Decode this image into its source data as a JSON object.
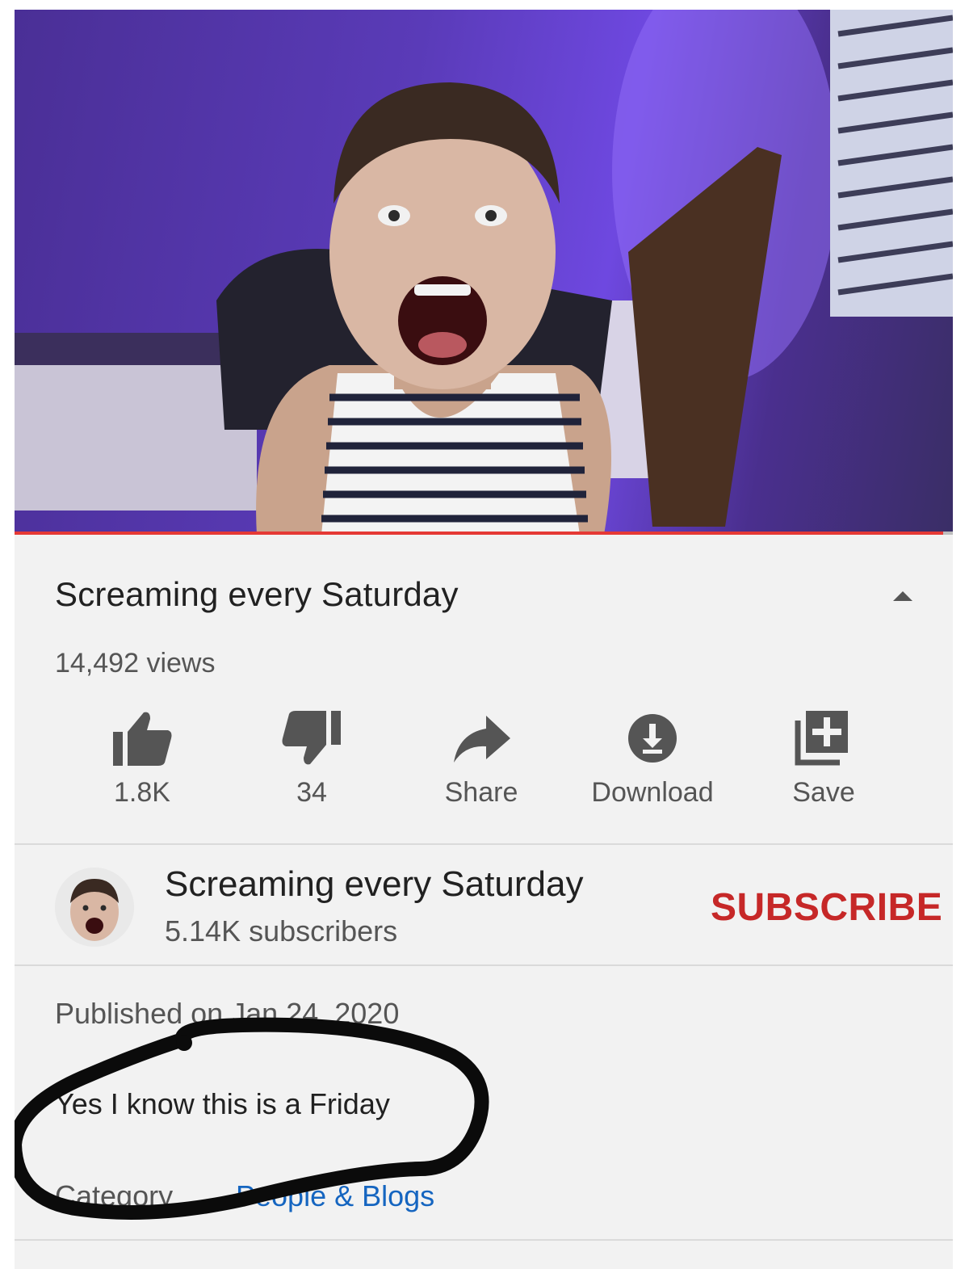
{
  "video": {
    "progress_fraction": 0.99
  },
  "title": "Screaming every Saturday",
  "views": "14,492 views",
  "actions": {
    "like": {
      "label": "1.8K",
      "icon": "thumb-up-icon"
    },
    "dislike": {
      "label": "34",
      "icon": "thumb-down-icon"
    },
    "share": {
      "label": "Share",
      "icon": "share-arrow-icon"
    },
    "download": {
      "label": "Download",
      "icon": "download-icon"
    },
    "save": {
      "label": "Save",
      "icon": "playlist-add-icon"
    }
  },
  "channel": {
    "name": "Screaming every Saturday",
    "subscribers": "5.14K subscribers",
    "subscribe_label": "SUBSCRIBE"
  },
  "description": {
    "published": "Published on Jan 24, 2020",
    "text": "Yes I know this is a Friday",
    "category_label": "Category",
    "category_value": "People & Blogs"
  },
  "colors": {
    "accent_red": "#c62828",
    "link_blue": "#1565c0",
    "progress_red": "#e53935"
  }
}
